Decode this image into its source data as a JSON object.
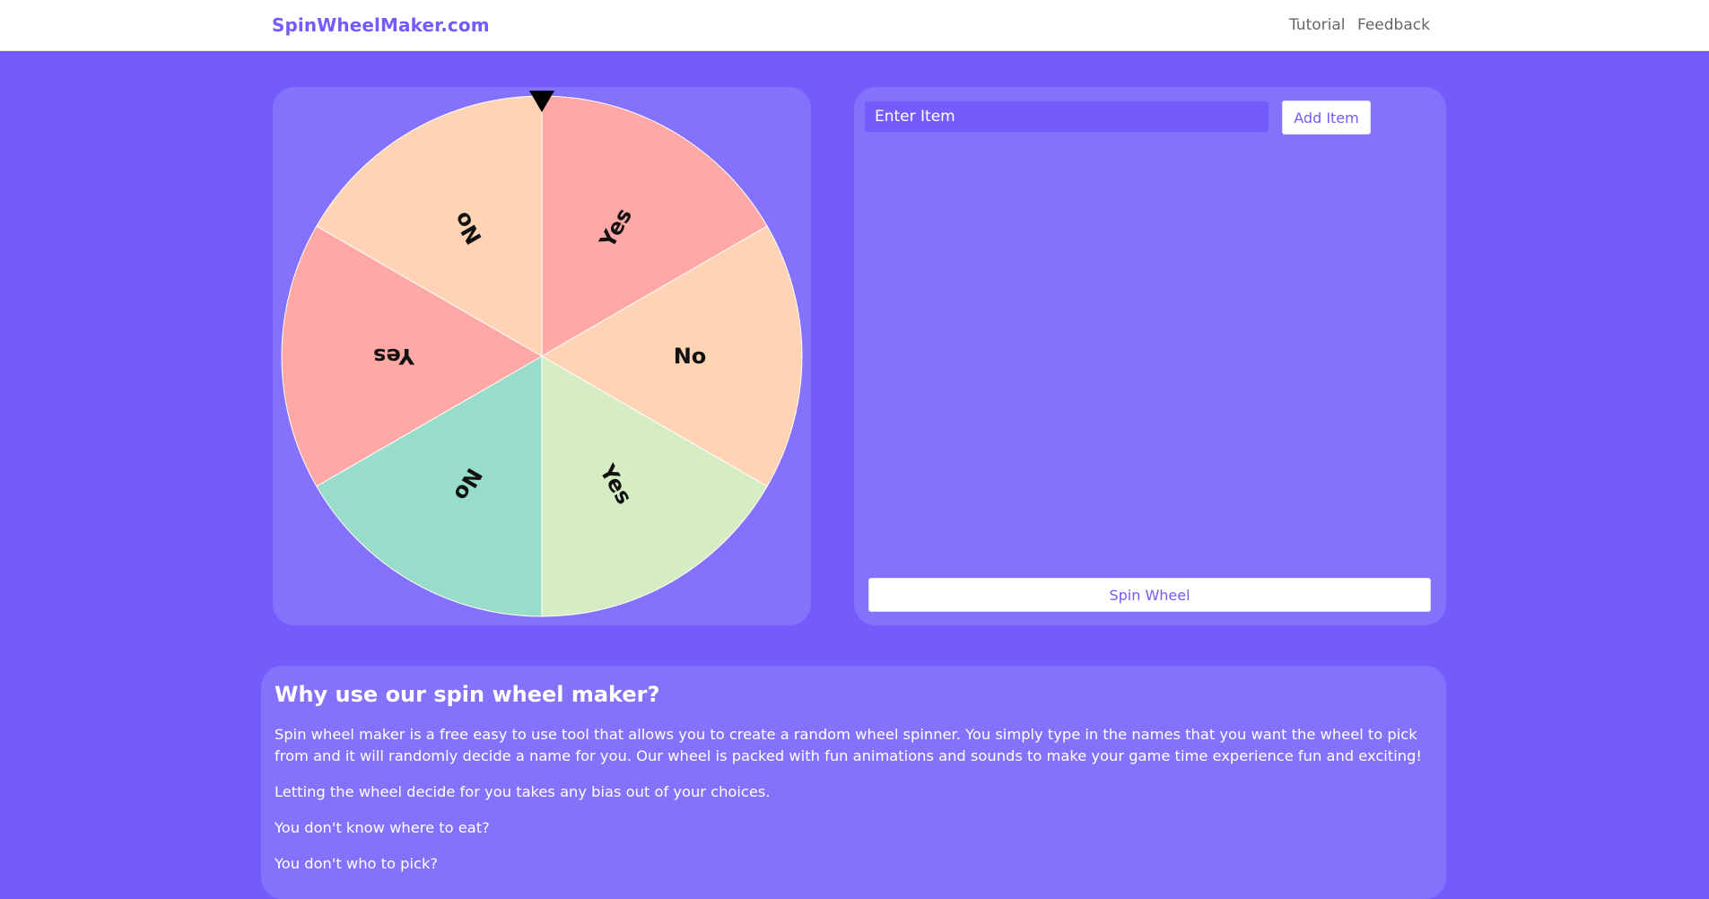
{
  "header": {
    "brand": "SpinWheelMaker.com",
    "nav": {
      "tutorial": "Tutorial",
      "feedback": "Feedback"
    }
  },
  "wheel": {
    "segments": [
      {
        "label": "Yes",
        "color": "#ffa8a6"
      },
      {
        "label": "No",
        "color": "#ffd3b3"
      },
      {
        "label": "Yes",
        "color": "#d6ecc3"
      },
      {
        "label": "No",
        "color": "#98ddca"
      },
      {
        "label": "Yes",
        "color": "#ffa8a6"
      },
      {
        "label": "No",
        "color": "#ffd3b3"
      }
    ]
  },
  "items_panel": {
    "input_placeholder": "Enter Item",
    "add_button": "Add Item",
    "spin_button": "Spin Wheel"
  },
  "info": {
    "title": "Why use our spin wheel maker?",
    "paragraphs": [
      "Spin wheel maker is a free easy to use tool that allows you to create a random wheel spinner. You simply type in the names that you want the wheel to pick from and it will randomly decide a name for you. Our wheel is packed with fun animations and sounds to make your game time experience fun and exciting!",
      "Letting the wheel decide for you takes any bias out of your choices.",
      "You don't know where to eat?",
      "You don't who to pick?"
    ]
  },
  "colors": {
    "background": "#735cfb",
    "card": "#8471fc",
    "accent": "#735cfb",
    "pointer": "#000000"
  }
}
